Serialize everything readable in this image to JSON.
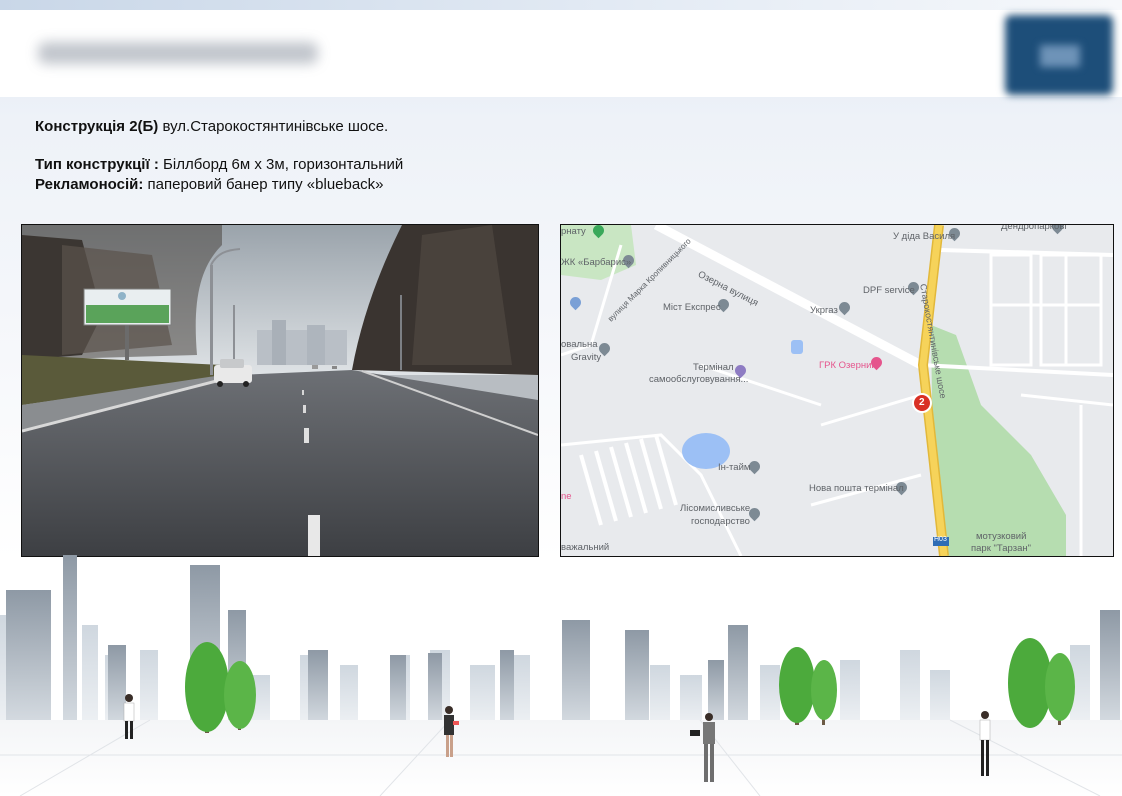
{
  "info": {
    "construction_label": "Конструкція 2(Б)",
    "construction_value": " вул.Старокостянтинівське  шосе.",
    "type_label": "Тип конструкції :",
    "type_value": " Біллборд  6м х  3м, горизонтальний",
    "carrier_label": "Рекламоносій:",
    "carrier_value": " паперовий  банер типу  «blueback»"
  },
  "map": {
    "labels": {
      "dendro": "Дендропаркові",
      "u_dida": "У діда Василя",
      "ternatu": "рнату",
      "barbarys": "ЖК «Барбарис»",
      "ozerna": "Озерна вулиця",
      "kropyv": "вулиця Марка Кропивницького",
      "dpf": "DPF service",
      "mist": "Міст Експрес",
      "ukrgaz": "Укргаз",
      "gravity": "Gravity",
      "novalna": "овальна",
      "terminal1": "Термінал",
      "terminal2": "самообслуговування...",
      "grk": "ГРК Озерний",
      "road": "Старокостянтинівське шосе",
      "intaim": "Ін-тайм",
      "np": "Нова пошта термінал",
      "lis1": "Лісомисливське",
      "lis2": "господарство",
      "park1": "мотузковий",
      "park2": "парк \"Тарзан\"",
      "vazhalnyi": "важальний",
      "h03": "H03",
      "ne": "ne"
    },
    "marker": "2"
  },
  "colors": {
    "map_bg": "#e8eaed",
    "road_yellow": "#f6d35a",
    "park_green": "#b6ddb0",
    "water": "#9cc0f5",
    "marker_red": "#d93025"
  }
}
